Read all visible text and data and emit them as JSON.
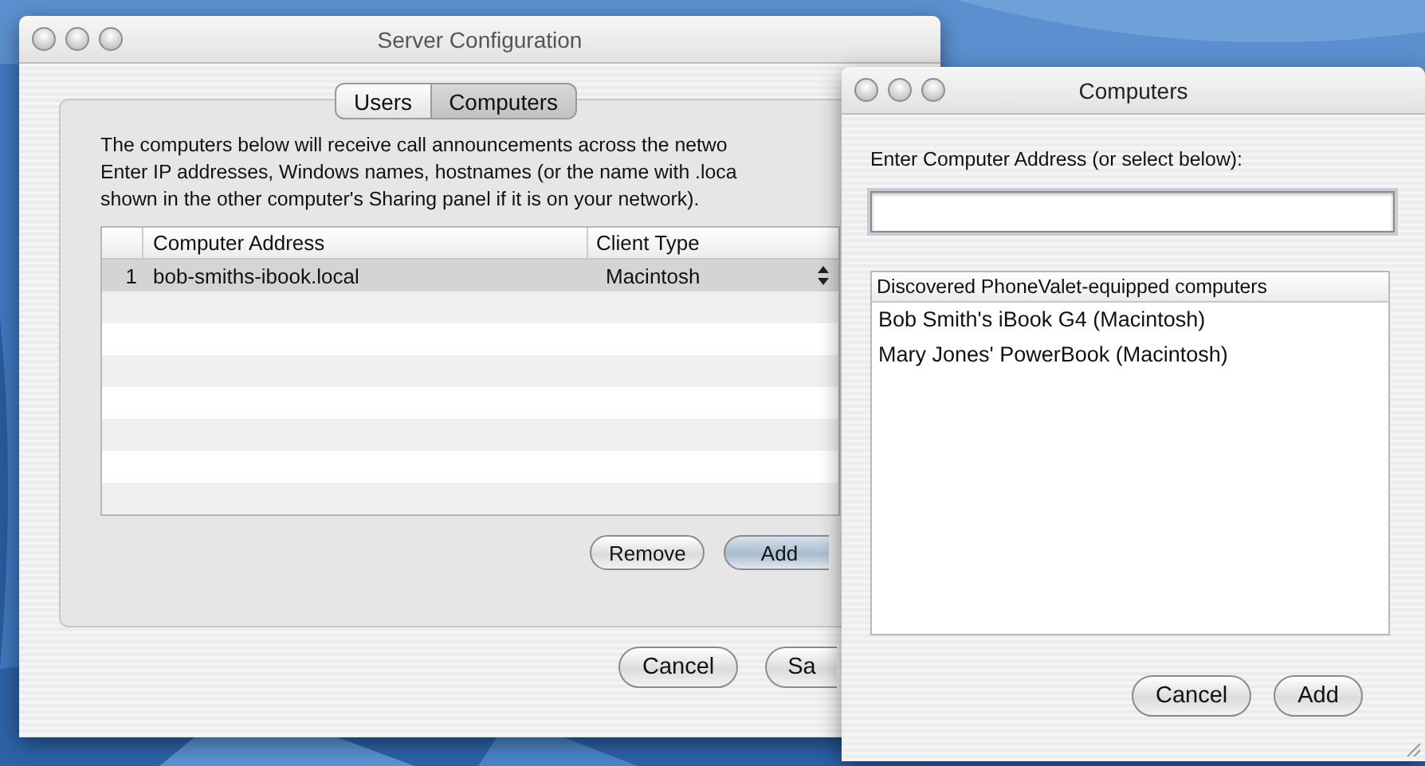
{
  "server_window": {
    "title": "Server Configuration",
    "tabs": [
      {
        "label": "Users",
        "selected": false
      },
      {
        "label": "Computers",
        "selected": true
      }
    ],
    "description": [
      "The computers below will receive call announcements across the netwo",
      "Enter IP addresses, Windows names, hostnames (or the name with .loca",
      "shown in the other computer's Sharing panel if it is on your network)."
    ],
    "table": {
      "columns": [
        "Computer Address",
        "Client Type"
      ],
      "rows": [
        {
          "index": "1",
          "address": "bob-smiths-ibook.local",
          "client_type": "Macintosh",
          "selected": true
        }
      ]
    },
    "list_buttons": [
      {
        "label": "Remove",
        "default": false
      },
      {
        "label": "Add",
        "default": true
      }
    ],
    "buttons": [
      {
        "label": "Cancel",
        "default": false
      },
      {
        "label": "Sa",
        "default": false
      }
    ]
  },
  "computers_window": {
    "title": "Computers",
    "prompt": "Enter Computer Address (or select below):",
    "list": {
      "header": "Discovered PhoneValet-equipped computers",
      "items": [
        {
          "label": "Bob Smith's iBook G4 (Macintosh)",
          "selected": false
        },
        {
          "label": "Mary Jones' PowerBook (Macintosh)",
          "selected": false
        }
      ]
    },
    "buttons": [
      {
        "label": "Cancel",
        "default": false
      },
      {
        "label": "Add",
        "default": false
      }
    ]
  }
}
